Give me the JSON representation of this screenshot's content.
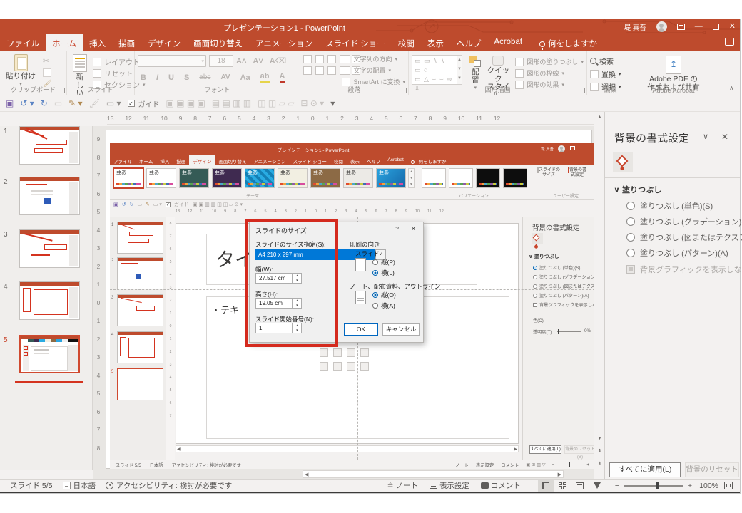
{
  "titlebar": {
    "title": "プレゼンテーション1 - PowerPoint",
    "user": "堤 真吾"
  },
  "tabs": {
    "file": "ファイル",
    "home": "ホーム",
    "insert": "挿入",
    "draw": "描画",
    "design": "デザイン",
    "transitions": "画面切り替え",
    "animations": "アニメーション",
    "slideshow": "スライド ショー",
    "review": "校閲",
    "view": "表示",
    "help": "ヘルプ",
    "acrobat": "Acrobat",
    "tellme": "何をしますか"
  },
  "ribbon": {
    "paste": "貼り付け",
    "new_slide_l1": "新しい",
    "new_slide_l2": "スライド",
    "layout": "レイアウト",
    "reset": "リセット",
    "section": "セクション",
    "font_size": "18",
    "bold": "B",
    "italic": "I",
    "underline": "U",
    "strike": "S",
    "abc": "abc",
    "av": "AV",
    "aa": "Aa",
    "a": "A",
    "text_dir": "文字列の方向",
    "text_align": "文字の配置",
    "smartart": "SmartArt に変換",
    "shapes_r1": "▭ ▭ ∖ ∖ ▭ ○",
    "shapes_r2": "▭ △ ⌣ ⌣ ⇨ ⇩",
    "shapes_r3": "○ ◦ ∿ ∿ { }",
    "arrange": "配置",
    "quick_l1": "クイック",
    "quick_l2": "スタイル",
    "shape_fill": "図形の塗りつぶし",
    "shape_outline": "図形の枠線",
    "shape_effects": "図形の効果",
    "find": "検索",
    "replace": "置換",
    "select": "選択",
    "acrobat_l1": "Adobe PDF の",
    "acrobat_l2": "作成および共有",
    "g_clipboard": "クリップボード",
    "g_slides": "スライド",
    "g_font": "フォント",
    "g_paragraph": "段落",
    "g_drawing": "図形描画",
    "g_editing": "編集",
    "g_acrobat": "Adobe Acrobat"
  },
  "qat": {
    "guide": "ガイド"
  },
  "rulers": {
    "h": "13 12 11 10 9 8 7 6 5 4 3 2 1 0 1 2 3 4 5 6 7 8 9 10 11 12",
    "v": "9 8 7 6 5 4 3 2 1 0 1 2 3 4 5 6 7 8"
  },
  "thumbs": {
    "n1": "1",
    "n2": "2",
    "n3": "3",
    "n4": "4",
    "n5": "5"
  },
  "shot": {
    "title": "プレゼンテーション1 - PowerPoint",
    "user": "堤 真吾",
    "tabs": {
      "file": "ファイル",
      "home": "ホーム",
      "insert": "挿入",
      "draw": "描画",
      "design": "デザイン",
      "transitions": "画面切り替え",
      "animations": "アニメーション",
      "slideshow": "スライド ショー",
      "review": "校閲",
      "view": "表示",
      "help": "ヘルプ",
      "acrobat": "Acrobat",
      "tellme": "何をしますか"
    },
    "theme_char": "亜あ",
    "themes": [
      {
        "css": "background:#ffffff;color:#3b3a39"
      },
      {
        "css": "background:#ffffff;color:#3b3a39"
      },
      {
        "css": "background:#355B56;color:#ffffff"
      },
      {
        "css": "background:#3F2A50;color:#ffffff"
      },
      {
        "css": "background:repeating-linear-gradient(45deg,#29ABE2 0 4px,#1580B5 4px 8px);color:#ffffff"
      },
      {
        "css": "background:#F2EFE2;color:#3b3a39"
      },
      {
        "css": "background:#8C6A45;color:#ffffff"
      },
      {
        "css": "background:#ECEAE6;color:#3b3a39"
      },
      {
        "css": "background:linear-gradient(135deg,#2AA4E0,#1567A8);color:#ffffff"
      }
    ],
    "variants": [
      {
        "css": "background:#ffffff"
      },
      {
        "css": "background:#ffffff"
      },
      {
        "css": "background:#0d0d0d"
      },
      {
        "css": "background:#0d0d0d"
      }
    ],
    "g_theme": "テーマ",
    "g_variants": "バリエーション",
    "g_custom": "ユーザー設定",
    "btn_size_l1": "スライドの",
    "btn_size_l2": "サイズ",
    "btn_bg_l1": "背景の書",
    "btn_bg_l2": "式設定",
    "guide": "ガイド",
    "ruler": "13 12 11 10 9 8 7 6 5 4 3 2 1 0 1 2 3 4 5 6 7 8 9 10 11 12",
    "vruler": "8 7 6 5 4 3 2 1 0 1 2 3 4 5 6 7",
    "thumbs": {
      "n1": "1",
      "n2": "2",
      "n3": "3",
      "n4": "4",
      "n5": "5"
    },
    "slide_title": "タイ",
    "slide_bullet": "・テキ",
    "panel": {
      "title": "背景の書式設定",
      "fill": "塗りつぶし",
      "opt1": "塗りつぶし (単色)(S)",
      "opt2": "塗りつぶし (グラデーション)(G)",
      "opt3": "塗りつぶし (図またはテクスチャ)(P)",
      "opt4": "塗りつぶし (パターン)(A)",
      "hide": "背景グラフィックを表示しない(H)",
      "color": "色(C)",
      "transp": "透明度(T)",
      "transp_val": "0%",
      "apply": "すべてに適用(L)",
      "reset": "背景のリセット(B)"
    },
    "status": {
      "slide": "スライド 5/5",
      "lang": "日本語",
      "access": "アクセシビリティ: 検討が必要です",
      "notes": "ノート",
      "display": "表示設定",
      "comments": "コメント"
    }
  },
  "dialog": {
    "title": "スライドのサイズ",
    "help": "?",
    "close": "✕",
    "size_label": "スライドのサイズ指定(S):",
    "size_value": "A4 210 x 297 mm",
    "width_label": "幅(W):",
    "width_value": "27.517 cm",
    "height_label": "高さ(H):",
    "height_value": "19.05 cm",
    "num_label": "スライド開始番号(N):",
    "num_value": "1",
    "orient": "印刷の向き",
    "slide_group": "スライド",
    "portrait": "縦(P)",
    "landscape": "横(L)",
    "notes_group": "ノート、配布資料、アウトライン",
    "n_portrait": "縦(O)",
    "n_landscape": "横(A)",
    "ok": "OK",
    "cancel": "キャンセル"
  },
  "panel": {
    "title": "背景の書式設定",
    "fill": "塗りつぶし",
    "opt1": "塗りつぶし (単色)(S)",
    "opt2": "塗りつぶし (グラデーション)(G)",
    "opt3": "塗りつぶし (図またはテクスチャ)(P)",
    "opt4": "塗りつぶし (パターン)(A)",
    "hide": "背景グラフィックを表示しない(H)",
    "apply": "すべてに適用(L)",
    "reset": "背景のリセット(B)"
  },
  "status": {
    "slide": "スライド 5/5",
    "lang": "日本語",
    "access": "アクセシビリティ: 検討が必要です",
    "notes": "ノート",
    "display": "表示設定",
    "comments": "コメント",
    "zoom": "100%"
  }
}
